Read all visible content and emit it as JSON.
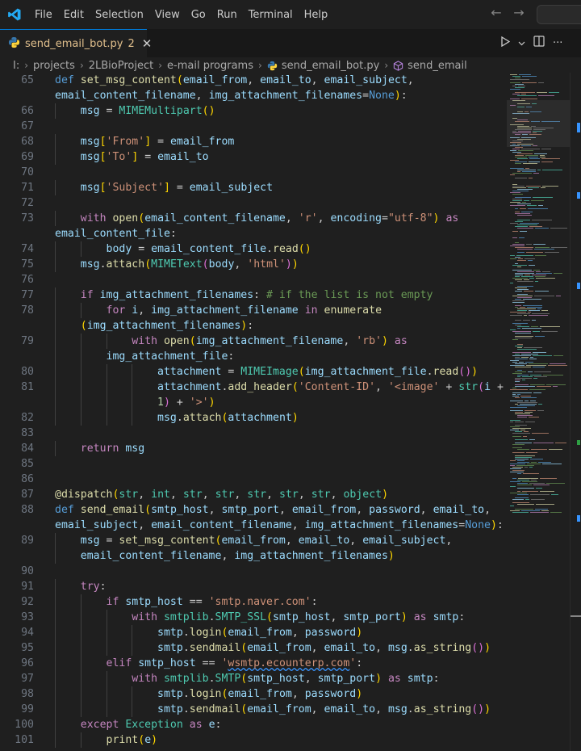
{
  "menu": [
    "File",
    "Edit",
    "Selection",
    "View",
    "Go",
    "Run",
    "Terminal",
    "Help"
  ],
  "tab": {
    "filename": "send_email_bot.py",
    "problem_count": "2",
    "close_glyph": "✕"
  },
  "breadcrumb": {
    "drive": "I:",
    "folders": [
      "projects",
      "2LBioProject",
      "e-mail programs"
    ],
    "file": "send_email_bot.py",
    "symbol": "send_email"
  },
  "colors": {
    "accent": "#0078d4",
    "python_blue": "#3776ab",
    "python_yellow": "#ffd43b",
    "modified_tab": "#e2c08d"
  },
  "icons": [
    "vscode-logo-icon",
    "back-arrow-icon",
    "forward-arrow-icon",
    "python-file-icon",
    "close-icon",
    "run-icon",
    "chevron-down-icon",
    "split-editor-icon",
    "more-actions-icon",
    "symbol-method-icon"
  ],
  "code_lines": [
    {
      "n": "65",
      "segs": [
        [
          "k",
          "def "
        ],
        [
          "f",
          "set_msg_content"
        ],
        [
          "p1",
          "("
        ],
        [
          "v",
          "email_from"
        ],
        [
          "",
          ","
        ],
        [
          "",
          " "
        ],
        [
          "v",
          "email_to"
        ],
        [
          "",
          ", "
        ],
        [
          "v",
          "email_subject"
        ],
        [
          "",
          ","
        ]
      ]
    },
    {
      "n": "",
      "segs": [
        [
          "v",
          "email_content_filename"
        ],
        [
          "",
          ", "
        ],
        [
          "v",
          "img_attachment_filenames"
        ],
        [
          "",
          "="
        ],
        [
          "k",
          "None"
        ],
        [
          "p1",
          ")"
        ],
        [
          "",
          ":"
        ]
      ]
    },
    {
      "n": "66",
      "segs": [
        [
          "",
          "    "
        ],
        [
          "v",
          "msg"
        ],
        [
          "",
          " = "
        ],
        [
          "t",
          "MIMEMultipart"
        ],
        [
          "p1",
          "()"
        ]
      ]
    },
    {
      "n": "67",
      "segs": []
    },
    {
      "n": "68",
      "segs": [
        [
          "",
          "    "
        ],
        [
          "v",
          "msg"
        ],
        [
          "p1",
          "["
        ],
        [
          "s",
          "'From'"
        ],
        [
          "p1",
          "]"
        ],
        [
          "",
          " = "
        ],
        [
          "v",
          "email_from"
        ]
      ]
    },
    {
      "n": "69",
      "segs": [
        [
          "",
          "    "
        ],
        [
          "v",
          "msg"
        ],
        [
          "p1",
          "["
        ],
        [
          "s",
          "'To'"
        ],
        [
          "p1",
          "]"
        ],
        [
          "",
          " = "
        ],
        [
          "v",
          "email_to"
        ]
      ]
    },
    {
      "n": "70",
      "segs": []
    },
    {
      "n": "71",
      "segs": [
        [
          "",
          "    "
        ],
        [
          "v",
          "msg"
        ],
        [
          "p1",
          "["
        ],
        [
          "s",
          "'Subject'"
        ],
        [
          "p1",
          "]"
        ],
        [
          "",
          " = "
        ],
        [
          "v",
          "email_subject"
        ]
      ]
    },
    {
      "n": "72",
      "segs": []
    },
    {
      "n": "73",
      "segs": [
        [
          "",
          "    "
        ],
        [
          "kc",
          "with "
        ],
        [
          "f",
          "open"
        ],
        [
          "p1",
          "("
        ],
        [
          "v",
          "email_content_filename"
        ],
        [
          "",
          ", "
        ],
        [
          "s",
          "'r'"
        ],
        [
          "",
          ", "
        ],
        [
          "v",
          "encoding"
        ],
        [
          "",
          "="
        ],
        [
          "s",
          "\"utf-8\""
        ],
        [
          "p1",
          ")"
        ],
        [
          "",
          " "
        ],
        [
          "kc",
          "as"
        ]
      ]
    },
    {
      "n": "",
      "segs": [
        [
          "v",
          "email_content_file"
        ],
        [
          "",
          ":"
        ]
      ]
    },
    {
      "n": "74",
      "segs": [
        [
          "",
          "        "
        ],
        [
          "v",
          "body"
        ],
        [
          "",
          " = "
        ],
        [
          "v",
          "email_content_file"
        ],
        [
          "",
          "."
        ],
        [
          "f",
          "read"
        ],
        [
          "p1",
          "()"
        ]
      ]
    },
    {
      "n": "75",
      "segs": [
        [
          "",
          "    "
        ],
        [
          "v",
          "msg"
        ],
        [
          "",
          "."
        ],
        [
          "f",
          "attach"
        ],
        [
          "p1",
          "("
        ],
        [
          "t",
          "MIMEText"
        ],
        [
          "p2",
          "("
        ],
        [
          "v",
          "body"
        ],
        [
          "",
          ", "
        ],
        [
          "s",
          "'html'"
        ],
        [
          "p2",
          ")"
        ],
        [
          "p1",
          ")"
        ]
      ]
    },
    {
      "n": "76",
      "segs": []
    },
    {
      "n": "77",
      "segs": [
        [
          "",
          "    "
        ],
        [
          "kc",
          "if "
        ],
        [
          "v",
          "img_attachment_filenames"
        ],
        [
          "",
          ": "
        ],
        [
          "c",
          "# if the list is not empty"
        ]
      ]
    },
    {
      "n": "78",
      "segs": [
        [
          "",
          "        "
        ],
        [
          "kc",
          "for "
        ],
        [
          "v",
          "i"
        ],
        [
          "",
          ", "
        ],
        [
          "v",
          "img_attachment_filename"
        ],
        [
          "",
          " "
        ],
        [
          "kc",
          "in "
        ],
        [
          "f",
          "enumerate"
        ]
      ]
    },
    {
      "n": "",
      "segs": [
        [
          "",
          "    "
        ],
        [
          "p1",
          "("
        ],
        [
          "v",
          "img_attachment_filenames"
        ],
        [
          "p1",
          ")"
        ],
        [
          "",
          ":"
        ]
      ]
    },
    {
      "n": "79",
      "segs": [
        [
          "",
          "            "
        ],
        [
          "kc",
          "with "
        ],
        [
          "f",
          "open"
        ],
        [
          "p1",
          "("
        ],
        [
          "v",
          "img_attachment_filename"
        ],
        [
          "",
          ", "
        ],
        [
          "s",
          "'rb'"
        ],
        [
          "p1",
          ")"
        ],
        [
          "",
          " "
        ],
        [
          "kc",
          "as"
        ]
      ]
    },
    {
      "n": "",
      "segs": [
        [
          "",
          "        "
        ],
        [
          "v",
          "img_attachment_file"
        ],
        [
          "",
          ":"
        ]
      ]
    },
    {
      "n": "80",
      "segs": [
        [
          "",
          "                "
        ],
        [
          "v",
          "attachment"
        ],
        [
          "",
          " = "
        ],
        [
          "t",
          "MIMEImage"
        ],
        [
          "p1",
          "("
        ],
        [
          "v",
          "img_attachment_file"
        ],
        [
          "",
          "."
        ],
        [
          "f",
          "read"
        ],
        [
          "p2",
          "()"
        ],
        [
          "p1",
          ")"
        ]
      ]
    },
    {
      "n": "81",
      "segs": [
        [
          "",
          "                "
        ],
        [
          "v",
          "attachment"
        ],
        [
          "",
          "."
        ],
        [
          "f",
          "add_header"
        ],
        [
          "p1",
          "("
        ],
        [
          "s",
          "'Content-ID'"
        ],
        [
          "",
          ", "
        ],
        [
          "s",
          "'<image'"
        ],
        [
          "",
          " + "
        ],
        [
          "t",
          "str"
        ],
        [
          "p2",
          "("
        ],
        [
          "v",
          "i"
        ],
        [
          "",
          " +"
        ]
      ]
    },
    {
      "n": "",
      "segs": [
        [
          "",
          "                "
        ],
        [
          "n",
          "1"
        ],
        [
          "p2",
          ")"
        ],
        [
          "",
          " + "
        ],
        [
          "s",
          "'>'"
        ],
        [
          "p1",
          ")"
        ]
      ]
    },
    {
      "n": "82",
      "segs": [
        [
          "",
          "                "
        ],
        [
          "v",
          "msg"
        ],
        [
          "",
          "."
        ],
        [
          "f",
          "attach"
        ],
        [
          "p1",
          "("
        ],
        [
          "v",
          "attachment"
        ],
        [
          "p1",
          ")"
        ]
      ]
    },
    {
      "n": "83",
      "segs": []
    },
    {
      "n": "84",
      "segs": [
        [
          "",
          "    "
        ],
        [
          "kc",
          "return "
        ],
        [
          "v",
          "msg"
        ]
      ]
    },
    {
      "n": "85",
      "segs": []
    },
    {
      "n": "86",
      "segs": []
    },
    {
      "n": "87",
      "segs": [
        [
          "f",
          "@dispatch"
        ],
        [
          "p1",
          "("
        ],
        [
          "t",
          "str"
        ],
        [
          "",
          ", "
        ],
        [
          "t",
          "int"
        ],
        [
          "",
          ", "
        ],
        [
          "t",
          "str"
        ],
        [
          "",
          ", "
        ],
        [
          "t",
          "str"
        ],
        [
          "",
          ", "
        ],
        [
          "t",
          "str"
        ],
        [
          "",
          ", "
        ],
        [
          "t",
          "str"
        ],
        [
          "",
          ", "
        ],
        [
          "t",
          "str"
        ],
        [
          "",
          ", "
        ],
        [
          "t",
          "object"
        ],
        [
          "p1",
          ")"
        ]
      ]
    },
    {
      "n": "88",
      "segs": [
        [
          "k",
          "def "
        ],
        [
          "f",
          "send_email"
        ],
        [
          "p1",
          "("
        ],
        [
          "v",
          "smtp_host"
        ],
        [
          "",
          ", "
        ],
        [
          "v",
          "smtp_port"
        ],
        [
          "",
          ", "
        ],
        [
          "v",
          "email_from"
        ],
        [
          "",
          ", "
        ],
        [
          "v",
          "password"
        ],
        [
          "",
          ", "
        ],
        [
          "v",
          "email_to"
        ],
        [
          "",
          ","
        ]
      ]
    },
    {
      "n": "",
      "segs": [
        [
          "v",
          "email_subject"
        ],
        [
          "",
          ", "
        ],
        [
          "v",
          "email_content_filename"
        ],
        [
          "",
          ", "
        ],
        [
          "v",
          "img_attachment_filenames"
        ],
        [
          "",
          "="
        ],
        [
          "k",
          "None"
        ],
        [
          "p1",
          ")"
        ],
        [
          "",
          ":"
        ]
      ]
    },
    {
      "n": "89",
      "segs": [
        [
          "",
          "    "
        ],
        [
          "v",
          "msg"
        ],
        [
          "",
          " = "
        ],
        [
          "f",
          "set_msg_content"
        ],
        [
          "p1",
          "("
        ],
        [
          "v",
          "email_from"
        ],
        [
          "",
          ", "
        ],
        [
          "v",
          "email_to"
        ],
        [
          "",
          ", "
        ],
        [
          "v",
          "email_subject"
        ],
        [
          "",
          ","
        ]
      ]
    },
    {
      "n": "",
      "segs": [
        [
          "",
          "    "
        ],
        [
          "v",
          "email_content_filename"
        ],
        [
          "",
          ", "
        ],
        [
          "v",
          "img_attachment_filenames"
        ],
        [
          "p1",
          ")"
        ]
      ]
    },
    {
      "n": "90",
      "segs": []
    },
    {
      "n": "91",
      "segs": [
        [
          "",
          "    "
        ],
        [
          "kc",
          "try"
        ],
        [
          "",
          ":"
        ]
      ]
    },
    {
      "n": "92",
      "segs": [
        [
          "",
          "        "
        ],
        [
          "kc",
          "if "
        ],
        [
          "v",
          "smtp_host"
        ],
        [
          "",
          " == "
        ],
        [
          "s",
          "'smtp.naver.com'"
        ],
        [
          "",
          ":"
        ]
      ]
    },
    {
      "n": "93",
      "segs": [
        [
          "",
          "            "
        ],
        [
          "kc",
          "with "
        ],
        [
          "t",
          "smtplib"
        ],
        [
          "",
          "."
        ],
        [
          "t",
          "SMTP_SSL"
        ],
        [
          "p1",
          "("
        ],
        [
          "v",
          "smtp_host"
        ],
        [
          "",
          ", "
        ],
        [
          "v",
          "smtp_port"
        ],
        [
          "p1",
          ")"
        ],
        [
          "",
          " "
        ],
        [
          "kc",
          "as "
        ],
        [
          "v",
          "smtp"
        ],
        [
          "",
          ":"
        ]
      ]
    },
    {
      "n": "94",
      "segs": [
        [
          "",
          "                "
        ],
        [
          "v",
          "smtp"
        ],
        [
          "",
          "."
        ],
        [
          "f",
          "login"
        ],
        [
          "p1",
          "("
        ],
        [
          "v",
          "email_from"
        ],
        [
          "",
          ", "
        ],
        [
          "v",
          "password"
        ],
        [
          "p1",
          ")"
        ]
      ]
    },
    {
      "n": "95",
      "segs": [
        [
          "",
          "                "
        ],
        [
          "v",
          "smtp"
        ],
        [
          "",
          "."
        ],
        [
          "f",
          "sendmail"
        ],
        [
          "p1",
          "("
        ],
        [
          "v",
          "email_from"
        ],
        [
          "",
          ", "
        ],
        [
          "v",
          "email_to"
        ],
        [
          "",
          ", "
        ],
        [
          "v",
          "msg"
        ],
        [
          "",
          "."
        ],
        [
          "f",
          "as_string"
        ],
        [
          "p2",
          "()"
        ],
        [
          "p1",
          ")"
        ]
      ]
    },
    {
      "n": "96",
      "segs": [
        [
          "",
          "        "
        ],
        [
          "kc",
          "elif "
        ],
        [
          "v",
          "smtp_host"
        ],
        [
          "",
          " == "
        ],
        [
          "s",
          "'"
        ],
        [
          "s sq",
          "wsmtp.ecounterp.com"
        ],
        [
          "s",
          "'"
        ],
        [
          "",
          ":"
        ]
      ]
    },
    {
      "n": "97",
      "segs": [
        [
          "",
          "            "
        ],
        [
          "kc",
          "with "
        ],
        [
          "t",
          "smtplib"
        ],
        [
          "",
          "."
        ],
        [
          "t",
          "SMTP"
        ],
        [
          "p1",
          "("
        ],
        [
          "v",
          "smtp_host"
        ],
        [
          "",
          ", "
        ],
        [
          "v",
          "smtp_port"
        ],
        [
          "p1",
          ")"
        ],
        [
          "",
          " "
        ],
        [
          "kc",
          "as "
        ],
        [
          "v",
          "smtp"
        ],
        [
          "",
          ":"
        ]
      ]
    },
    {
      "n": "98",
      "segs": [
        [
          "",
          "                "
        ],
        [
          "v",
          "smtp"
        ],
        [
          "",
          "."
        ],
        [
          "f",
          "login"
        ],
        [
          "p1",
          "("
        ],
        [
          "v",
          "email_from"
        ],
        [
          "",
          ", "
        ],
        [
          "v",
          "password"
        ],
        [
          "p1",
          ")"
        ]
      ]
    },
    {
      "n": "99",
      "segs": [
        [
          "",
          "                "
        ],
        [
          "v",
          "smtp"
        ],
        [
          "",
          "."
        ],
        [
          "f",
          "sendmail"
        ],
        [
          "p1",
          "("
        ],
        [
          "v",
          "email_from"
        ],
        [
          "",
          ", "
        ],
        [
          "v",
          "email_to"
        ],
        [
          "",
          ", "
        ],
        [
          "v",
          "msg"
        ],
        [
          "",
          "."
        ],
        [
          "f",
          "as_string"
        ],
        [
          "p2",
          "()"
        ],
        [
          "p1",
          ")"
        ]
      ]
    },
    {
      "n": "100",
      "segs": [
        [
          "",
          "    "
        ],
        [
          "kc",
          "except "
        ],
        [
          "t",
          "Exception"
        ],
        [
          "",
          " "
        ],
        [
          "kc",
          "as "
        ],
        [
          "v",
          "e"
        ],
        [
          "",
          ":"
        ]
      ]
    },
    {
      "n": "101",
      "segs": [
        [
          "",
          "        "
        ],
        [
          "f",
          "print"
        ],
        [
          "p1",
          "("
        ],
        [
          "v",
          "e"
        ],
        [
          "p1",
          ")"
        ]
      ]
    }
  ]
}
